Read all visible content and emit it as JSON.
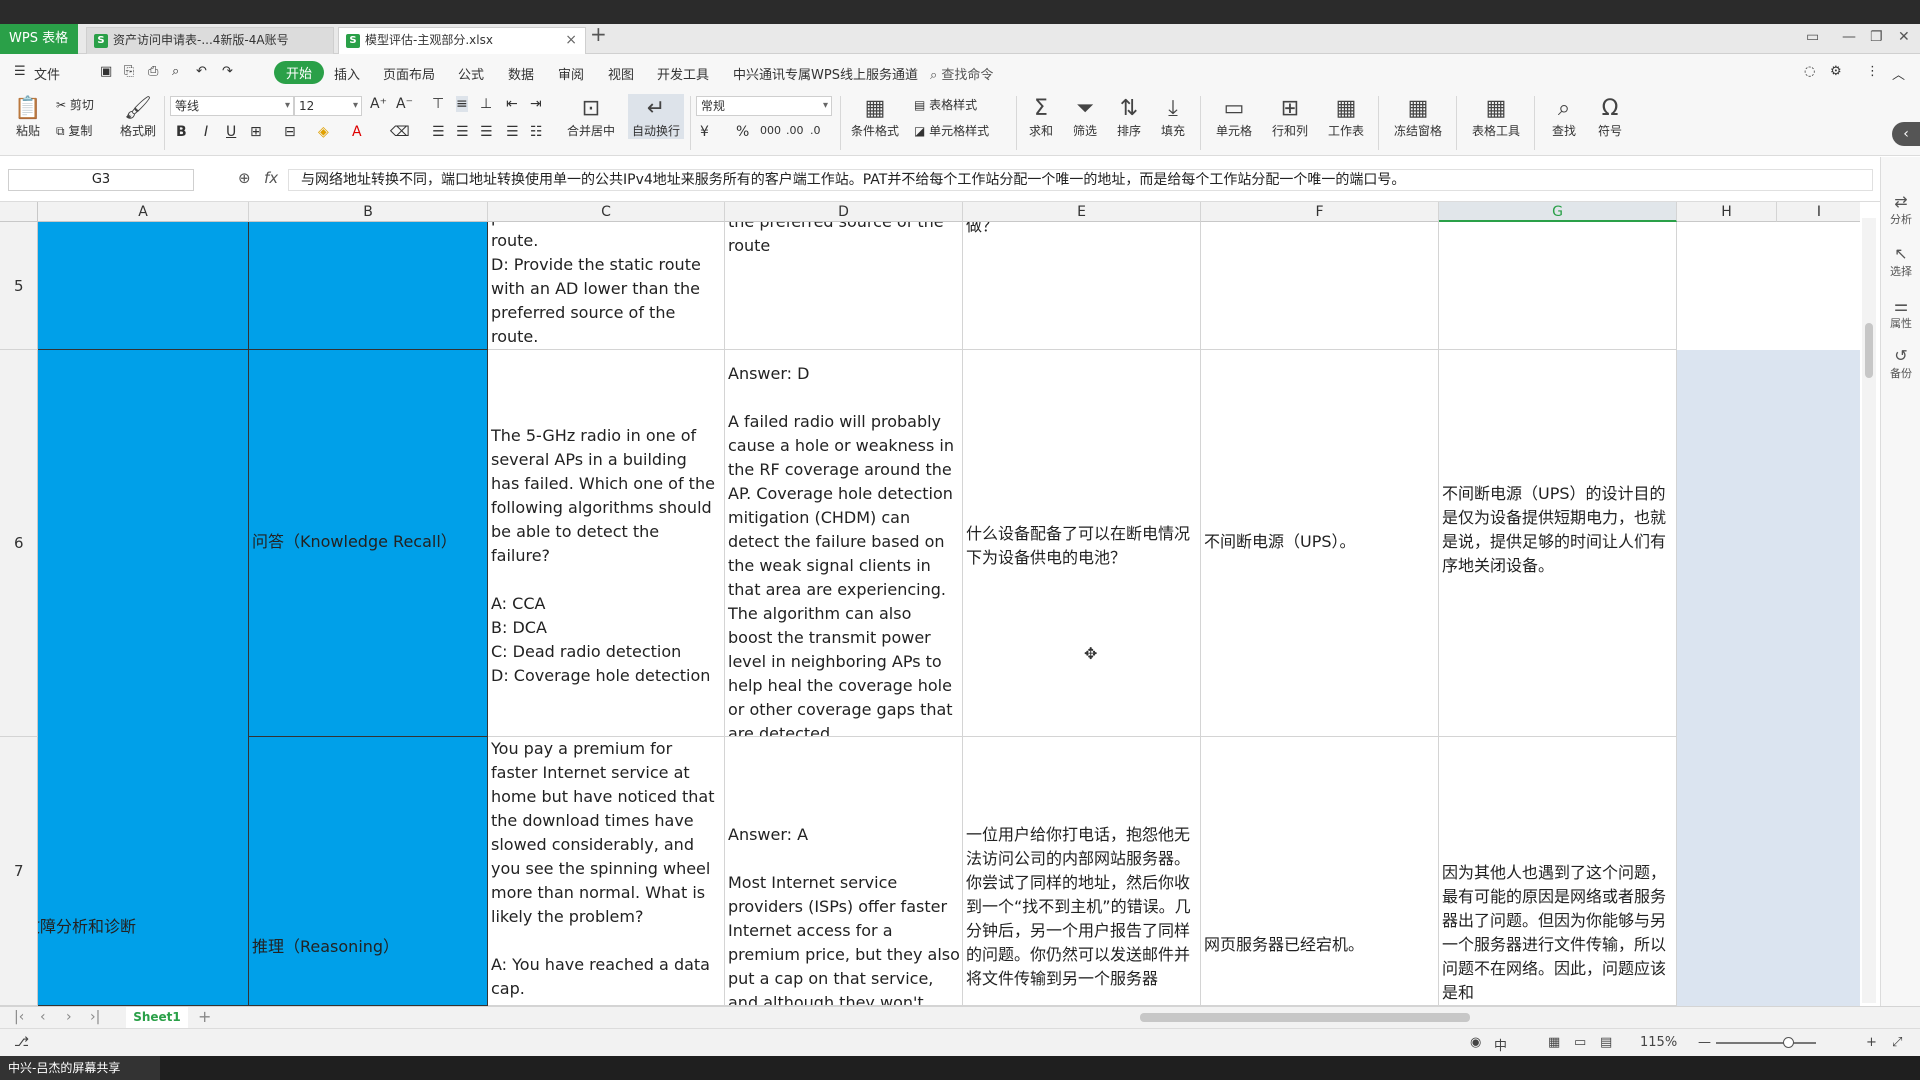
{
  "app": {
    "name": "WPS 表格",
    "tabs": [
      {
        "label": "资产访问申请表-...4新版-4A账号",
        "active": false
      },
      {
        "label": "模型评估-主观部分.xlsx",
        "active": true
      }
    ]
  },
  "menu": {
    "file": "文件",
    "start": "开始",
    "items": [
      "插入",
      "页面布局",
      "公式",
      "数据",
      "审阅",
      "视图",
      "开发工具",
      "中兴通讯专属WPS线上服务通道"
    ],
    "search": "查找命令"
  },
  "ribbon": {
    "paste": "粘贴",
    "cut": "剪切",
    "copy": "复制",
    "format_painter": "格式刷",
    "font_name": "等线",
    "font_size": "12",
    "merge_center": "合并居中",
    "wrap_text": "自动换行",
    "number_format": "常规",
    "conditional_format": "条件格式",
    "table_style": "表格样式",
    "cell_style": "单元格样式",
    "sum": "求和",
    "filter": "筛选",
    "sort": "排序",
    "fill": "填充",
    "cell": "单元格",
    "row_col": "行和列",
    "worksheet": "工作表",
    "freeze": "冻结窗格",
    "table_tools": "表格工具",
    "find": "查找",
    "symbol": "符号"
  },
  "formula_bar": {
    "name_box": "G3",
    "fx": "fx",
    "content": "与网络地址转换不同，端口地址转换使用单一的公共IPv4地址来服务所有的客户端工作站。PAT并不给每个工作站分配一个唯一的地址，而是给每个工作站分配一个唯一的端口号。"
  },
  "columns": [
    "A",
    "B",
    "C",
    "D",
    "E",
    "F",
    "G",
    "H",
    "I"
  ],
  "rows": [
    {
      "num": "5",
      "C": "C: Provide the static route\nwith an AD higher than the\npreferred source of the route.\nD: Provide the static route\nwith an AD lower than the\npreferred source of the route.",
      "D": "the preferred source of the\nroute",
      "E": "做？"
    },
    {
      "num": "6",
      "B": "问答（Knowledge Recall）",
      "C": "The 5-GHz radio in one of several APs in a building has failed. Which one of the following algorithms should be able to detect the failure?\n\nA: CCA\nB: DCA\nC: Dead radio detection\nD: Coverage hole detection",
      "D": "Answer: D\n\nA failed radio will probably cause a hole or weakness in the RF coverage around the AP. Coverage hole detection mitigation (CHDM) can detect the failure based on the weak signal clients in that area are experiencing. The algorithm can also boost the transmit power level in neighboring APs to help heal the coverage hole or other coverage gaps that are detected",
      "E": "什么设备配备了可以在断电情况下为设备供电的电池？",
      "F": "不间断电源（UPS）。",
      "G": "不间断电源（UPS）的设计目的是仅为设备提供短期电力，也就是说，提供足够的时间让人们有序地关闭设备。"
    },
    {
      "num": "7",
      "A": "故障分析和诊断",
      "B": "推理（Reasoning）",
      "C": "You pay a premium for faster Internet service at home but have noticed that the download times have slowed considerably, and you see the spinning wheel more than normal. What is likely the problem?\n\nA: You have reached a data cap.",
      "D": "Answer: A\n\nMost Internet service providers (ISPs) offer faster Internet access for a premium price, but they also put a cap on that service, and although they won't turn your service",
      "E": "一位用户给你打电话，抱怨他无法访问公司的内部网站服务器。你尝试了同样的地址，然后你收到一个“找不到主机”的错误。几分钟后，另一个用户报告了同样的问题。你仍然可以发送邮件并将文件传输到另一个服务器",
      "F": "网页服务器已经宕机。",
      "G": "因为其他人也遇到了这个问题，最有可能的原因是网络或者服务器出了问题。但因为你能够与另一个服务器进行文件传输，所以问题不在网络。因此，问题应该是和"
    }
  ],
  "side_panel": [
    "分析",
    "选择",
    "属性",
    "备份"
  ],
  "sheet_tabs": [
    "Sheet1"
  ],
  "status": {
    "zoom": "115%"
  },
  "taskbar": {
    "share": "中兴-吕杰的屏幕共享"
  },
  "colors": {
    "brand": "#2aa048",
    "cell_fill": "#00a0e9",
    "selection": "#dbe4f0"
  }
}
